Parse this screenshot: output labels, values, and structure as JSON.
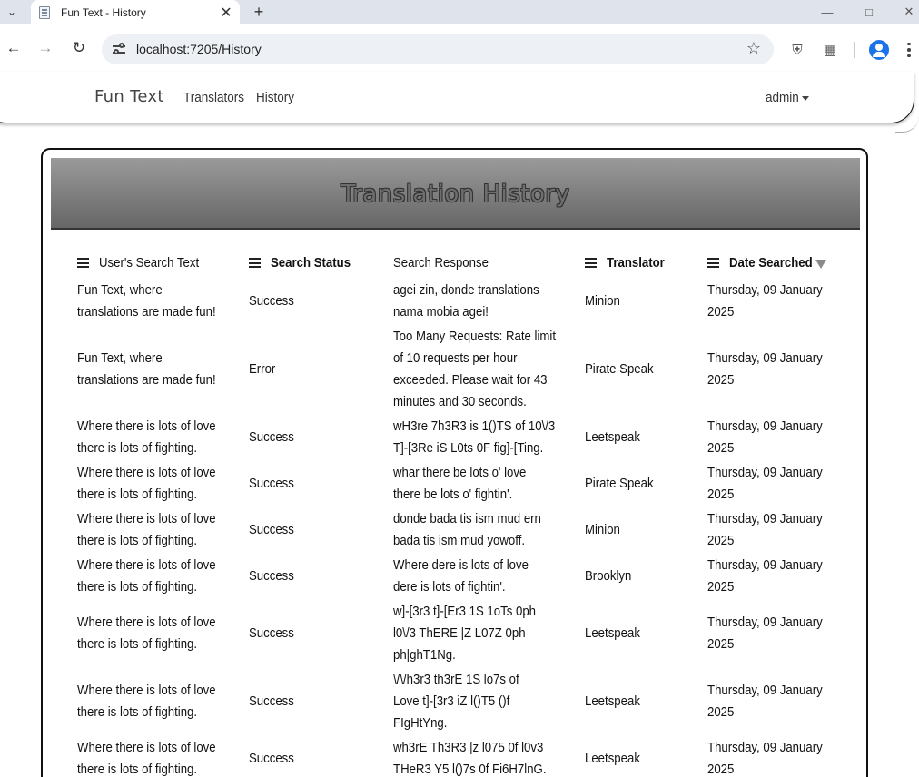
{
  "browser": {
    "tab_title": "Fun Text - History",
    "url": "localhost:7205/History"
  },
  "nav": {
    "brand": "Fun Text",
    "links": [
      "Translators",
      "History"
    ],
    "user": "admin"
  },
  "page": {
    "title": "Translation History"
  },
  "table": {
    "columns": [
      "User's Search Text",
      "Search Status",
      "Search Response",
      "Translator",
      "Date Searched"
    ],
    "rows": [
      {
        "text": [
          "Fun Text, where",
          "translations are made fun!"
        ],
        "status": "Success",
        "response": [
          "agei zin, donde translations",
          "nama mobia agei!"
        ],
        "translator": "Minion",
        "date": [
          "Thursday, 09 January",
          "2025"
        ]
      },
      {
        "text": [
          "Fun Text, where",
          "translations are made fun!"
        ],
        "status": "Error",
        "response": [
          "Too Many Requests: Rate limit",
          "of 10 requests per hour",
          "exceeded. Please wait for 43",
          "minutes and 30 seconds."
        ],
        "translator": "Pirate Speak",
        "date": [
          "Thursday, 09 January",
          "2025"
        ]
      },
      {
        "text": [
          "Where there is lots of love",
          "there is lots of fighting."
        ],
        "status": "Success",
        "response": [
          "wH3re 7h3R3 is 1()TS of 10\\/3",
          "T]-[3Re iS L0ts 0F fig]-[Ting."
        ],
        "translator": "Leetspeak",
        "date": [
          "Thursday, 09 January",
          "2025"
        ]
      },
      {
        "text": [
          "Where there is lots of love",
          "there is lots of fighting."
        ],
        "status": "Success",
        "response": [
          "whar there be lots o' love",
          "there be lots o' fightin'."
        ],
        "translator": "Pirate Speak",
        "date": [
          "Thursday, 09 January",
          "2025"
        ]
      },
      {
        "text": [
          "Where there is lots of love",
          "there is lots of fighting."
        ],
        "status": "Success",
        "response": [
          "donde bada tis ism mud ern",
          "bada tis ism mud yowoff."
        ],
        "translator": "Minion",
        "date": [
          "Thursday, 09 January",
          "2025"
        ]
      },
      {
        "text": [
          "Where there is lots of love",
          "there is lots of fighting."
        ],
        "status": "Success",
        "response": [
          "Where dere is lots of love",
          "dere is lots of fightin'."
        ],
        "translator": "Brooklyn",
        "date": [
          "Thursday, 09 January",
          "2025"
        ]
      },
      {
        "text": [
          "Where there is lots of love",
          "there is lots of fighting."
        ],
        "status": "Success",
        "response": [
          "w]-[3r3 t]-[Er3 1S 1oTs 0ph",
          "l0\\/3 ThERE |Z L07Z 0ph",
          "ph|ghT1Ng."
        ],
        "translator": "Leetspeak",
        "date": [
          "Thursday, 09 January",
          "2025"
        ]
      },
      {
        "text": [
          "Where there is lots of love",
          "there is lots of fighting."
        ],
        "status": "Success",
        "response": [
          "\\/\\/h3r3 th3rE 1S lo7s of",
          "Love t]-[3r3 iZ l()T5 ()f",
          "FIgHtYng."
        ],
        "translator": "Leetspeak",
        "date": [
          "Thursday, 09 January",
          "2025"
        ]
      },
      {
        "text": [
          "Where there is lots of love",
          "there is lots of fighting."
        ],
        "status": "Success",
        "response": [
          "wh3rE Th3R3 |z l075 0f l0v3",
          "THeR3 Y5 l()7s 0f Fi6H7lnG."
        ],
        "translator": "Leetspeak",
        "date": [
          "Thursday, 09 January",
          "2025"
        ]
      }
    ]
  }
}
